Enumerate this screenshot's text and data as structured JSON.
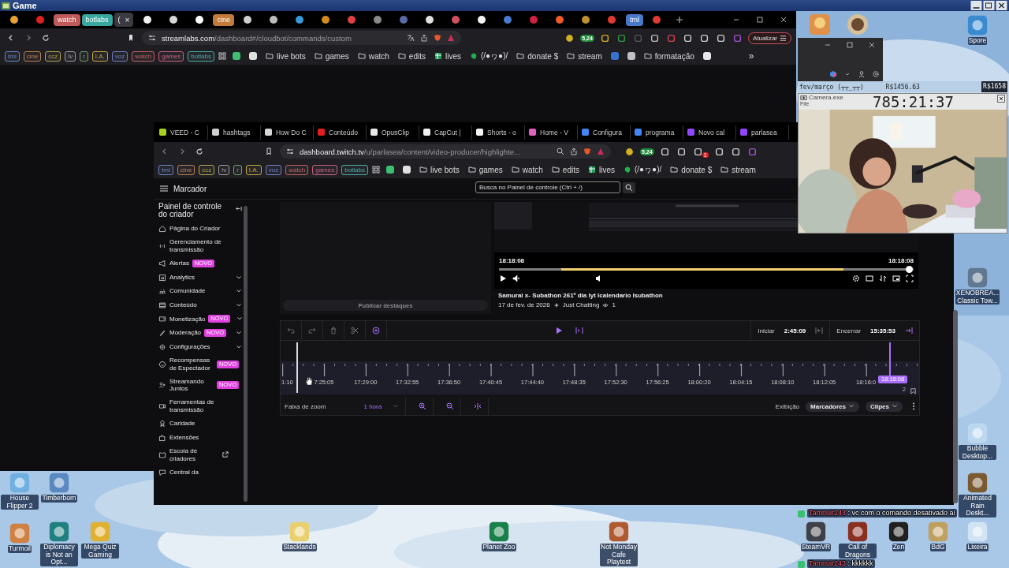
{
  "top_bar": {
    "title": "Game"
  },
  "browser": {
    "tabs": [
      {
        "kind": "icon",
        "color": "#e8a030",
        "selected": false
      },
      {
        "kind": "icon",
        "color": "#e02020",
        "selected": false
      },
      {
        "kind": "group",
        "label": "watch",
        "color": "#c05a5a",
        "selected": false
      },
      {
        "kind": "group",
        "label": "botlabs",
        "color": "#3aa8a0",
        "selected": false
      },
      {
        "kind": "text",
        "label": "(",
        "close": "×",
        "selected": true
      },
      {
        "kind": "icon",
        "color": "#f0f0f0",
        "selected": false
      },
      {
        "kind": "icon",
        "color": "#d8d8d8",
        "selected": false
      },
      {
        "kind": "icon",
        "color": "#ffffff",
        "selected": false
      },
      {
        "kind": "group",
        "label": "cine",
        "color": "#c07a3a",
        "selected": false
      },
      {
        "kind": "icon",
        "color": "#cfcfcf",
        "selected": false
      },
      {
        "kind": "icon",
        "color": "#bdbdbd",
        "selected": false
      },
      {
        "kind": "icon",
        "color": "#3a9ad8",
        "selected": false
      },
      {
        "kind": "icon",
        "color": "#d08a20",
        "selected": false
      },
      {
        "kind": "icon",
        "color": "#e04040",
        "selected": false
      },
      {
        "kind": "icon",
        "color": "#8a8a8a",
        "selected": false
      },
      {
        "kind": "icon",
        "color": "#5a6aa8",
        "selected": false
      },
      {
        "kind": "icon",
        "color": "#e0e0e0",
        "selected": false
      },
      {
        "kind": "icon",
        "color": "#d05060",
        "selected": false
      },
      {
        "kind": "icon",
        "color": "#f4f4f4",
        "selected": false
      },
      {
        "kind": "icon",
        "color": "#4a7ad0",
        "selected": false
      },
      {
        "kind": "icon",
        "color": "#d02040",
        "selected": false
      },
      {
        "kind": "icon",
        "color": "#f05a28",
        "selected": false
      },
      {
        "kind": "icon",
        "color": "#c09030",
        "selected": false
      },
      {
        "kind": "icon",
        "color": "#e03a30",
        "selected": false
      },
      {
        "kind": "group",
        "label": "tml",
        "color": "#4a78c8",
        "selected": false
      },
      {
        "kind": "icon",
        "color": "#e03a30",
        "selected": false
      }
    ],
    "url": {
      "host": "streamlabs.com",
      "path": "/dashboard#/cloudbot/commands/custom"
    },
    "extension_badge": "5,24",
    "update_button": "Atualizar",
    "bookmarks": [
      {
        "kind": "chip",
        "label": "tml",
        "color": "#6a86c8"
      },
      {
        "kind": "chip",
        "label": "cine",
        "color": "#c08050"
      },
      {
        "kind": "chip",
        "label": "ccz",
        "color": "#b8a848"
      },
      {
        "kind": "chip",
        "label": "lv",
        "color": "#a0a0a0"
      },
      {
        "kind": "chip",
        "label": "r",
        "color": "#70a070"
      },
      {
        "kind": "chip",
        "label": "I.A.",
        "color": "#c8a838"
      },
      {
        "kind": "chip",
        "label": "voz",
        "color": "#7080c8"
      },
      {
        "kind": "chip",
        "label": "watch",
        "color": "#c86060"
      },
      {
        "kind": "chip",
        "label": "games",
        "color": "#c86080"
      },
      {
        "kind": "chip",
        "label": "botlabs",
        "color": "#48b0a8"
      },
      {
        "kind": "apps"
      },
      {
        "kind": "icon",
        "color": "#3ac070"
      },
      {
        "kind": "icon",
        "color": "#e0e0e0"
      },
      {
        "kind": "folder",
        "label": "live bots"
      },
      {
        "kind": "folder",
        "label": "games"
      },
      {
        "kind": "folder",
        "label": "watch"
      },
      {
        "kind": "folder",
        "label": "edits"
      },
      {
        "kind": "sheet",
        "label": "lives"
      },
      {
        "kind": "note",
        "label": "(/●ヮ●)/"
      },
      {
        "kind": "folder",
        "label": "donate $"
      },
      {
        "kind": "folder",
        "label": "stream"
      },
      {
        "kind": "icon",
        "color": "#3a70d0"
      },
      {
        "kind": "icon",
        "color": "#c0c0c0"
      },
      {
        "kind": "folder",
        "label": "formatação"
      },
      {
        "kind": "icon",
        "color": "#e8e8e8"
      },
      {
        "kind": "overflow",
        "label": "»"
      }
    ]
  },
  "inner_browser": {
    "tabs": [
      {
        "label": "VEED - C",
        "color": "#a8d020",
        "selected": false
      },
      {
        "label": "hashtags",
        "color": "#d0d0d0",
        "selected": false
      },
      {
        "label": "How Do C",
        "color": "#d8d8d8",
        "selected": false
      },
      {
        "label": "Conteúdo",
        "color": "#e02020",
        "selected": false
      },
      {
        "label": "OpusClip",
        "color": "#e8e8e8",
        "selected": false
      },
      {
        "label": "CapCut |",
        "color": "#f0f0f0",
        "selected": false
      },
      {
        "label": "Shorts - o",
        "color": "#f4f4f4",
        "selected": false
      },
      {
        "label": "Home - V",
        "color": "#e060c0",
        "selected": false
      },
      {
        "label": "Configura",
        "color": "#4285f4",
        "selected": false
      },
      {
        "label": "programa",
        "color": "#4285f4",
        "selected": false
      },
      {
        "label": "Novo cal",
        "color": "#9146ff",
        "selected": false
      },
      {
        "label": "parlasea",
        "color": "#9146ff",
        "selected": false
      }
    ],
    "url": {
      "host": "dashboard.twitch.tv",
      "path": "/u/parlasea/content/video-producer/highlighte..."
    },
    "extension_badge": "5,24",
    "alert_badge": "1",
    "bookmarks": [
      {
        "kind": "chip",
        "label": "tml",
        "color": "#6a86c8"
      },
      {
        "kind": "chip",
        "label": "cine",
        "color": "#c08050"
      },
      {
        "kind": "chip",
        "label": "ccz",
        "color": "#b8a848"
      },
      {
        "kind": "chip",
        "label": "lv",
        "color": "#a0a0a0"
      },
      {
        "kind": "chip",
        "label": "r",
        "color": "#70a070"
      },
      {
        "kind": "chip",
        "label": "I.A.",
        "color": "#c8a838"
      },
      {
        "kind": "chip",
        "label": "voz",
        "color": "#7080c8"
      },
      {
        "kind": "chip",
        "label": "watch",
        "color": "#c86060"
      },
      {
        "kind": "chip",
        "label": "games",
        "color": "#c86080"
      },
      {
        "kind": "chip",
        "label": "botlabs",
        "color": "#48b0a8"
      },
      {
        "kind": "apps"
      },
      {
        "kind": "icon",
        "color": "#3ac070"
      },
      {
        "kind": "icon",
        "color": "#e0e0e0"
      },
      {
        "kind": "folder",
        "label": "live bots"
      },
      {
        "kind": "folder",
        "label": "games"
      },
      {
        "kind": "folder",
        "label": "watch"
      },
      {
        "kind": "folder",
        "label": "edits"
      },
      {
        "kind": "sheet",
        "label": "lives"
      },
      {
        "kind": "note",
        "label": "(/●ヮ●)/"
      },
      {
        "kind": "folder",
        "label": "donate $"
      },
      {
        "kind": "folder",
        "label": "stream"
      }
    ]
  },
  "page": {
    "menu_title": "Marcador",
    "search": {
      "placeholder": "Busca no Painel de controle (Ctrl + /)"
    },
    "sidebar": {
      "title": "Painel de controle do criador",
      "items": [
        {
          "label": "Página do Criador",
          "kind": "link",
          "selected": false
        },
        {
          "label": "Gerenciamento de transmissão",
          "kind": "link",
          "selected": false
        },
        {
          "label": "Alertas",
          "badge": "NOVO",
          "kind": "link",
          "selected": false
        },
        {
          "label": "Analytics",
          "kind": "menu",
          "selected": false
        },
        {
          "label": "Comunidade",
          "kind": "menu",
          "selected": false
        },
        {
          "label": "Conteúdo",
          "kind": "menu",
          "selected": false
        },
        {
          "label": "Monetização",
          "badge": "NOVO",
          "kind": "menu",
          "selected": false
        },
        {
          "label": "Moderação",
          "badge": "NOVO",
          "kind": "menu",
          "selected": false
        },
        {
          "label": "Configurações",
          "kind": "menu",
          "selected": false
        },
        {
          "label": "Recompensas de Espectador",
          "badge": "NOVO",
          "kind": "link",
          "selected": false
        },
        {
          "label": "Streamando Juntos",
          "badge": "NOVO",
          "kind": "link",
          "selected": false
        },
        {
          "label": "Ferramentas de transmissão",
          "kind": "link",
          "selected": false
        },
        {
          "label": "Caridade",
          "kind": "link",
          "selected": false
        },
        {
          "label": "Extensões",
          "kind": "link",
          "selected": false
        },
        {
          "label": "Escola de criadores",
          "kind": "external",
          "selected": false
        },
        {
          "label": "Central da",
          "kind": "link",
          "selected": false
        }
      ]
    },
    "publish_button": {
      "label": "Publicar destaques",
      "disabled": true
    },
    "video": {
      "time_left": "18:18:08",
      "time_right": "18:18:08",
      "level": 0.99,
      "title": "Samurai x- Subathon 261º dia lyt lcalendario lsubathon",
      "date": "17 de fev. de 2026",
      "category": "Just Chatting",
      "viewers": "1"
    },
    "editor": {
      "start_label": "Iniciar",
      "start_time": "2:45:09",
      "end_label": "Encerrar",
      "end_time": "15:35:53",
      "ticks": [
        "1:10",
        "7:25:05",
        "17:29:00",
        "17:32:55",
        "17:36:50",
        "17:40:45",
        "17:44:40",
        "17:48:35",
        "17:52:30",
        "17:56:25",
        "18:00:20",
        "18:04:15",
        "18:08:10",
        "18:12:05",
        "18:16:0"
      ],
      "marker": "18:18:08",
      "marker_count": "2",
      "zoom_label": "Faixa de zoom",
      "zoom_value": "1 hora",
      "view_label": "Exibição",
      "filters": [
        "Marcadores",
        "Clipes"
      ]
    }
  },
  "webcam": {
    "stats": [
      "fev/março (┬┬_┬┬)",
      "R$1456.63",
      "R$1658"
    ],
    "title": "Camera.exe",
    "menu": "File",
    "timer": "785:21:37"
  },
  "desktop_icons": [
    {
      "label": "Spore"
    },
    {
      "label": "XENOBREA... Classic Tow..."
    },
    {
      "label": "Bubble Desktop..."
    },
    {
      "label": "House Flipper 2"
    },
    {
      "label": "Timberborn"
    },
    {
      "label": "Animated Rain Deskt..."
    },
    {
      "label": "Turmoil"
    },
    {
      "label": "Diplomacy is Not an Opt..."
    },
    {
      "label": "Mega Quiz Gaming"
    },
    {
      "label": "Stacklands"
    },
    {
      "label": "Planet Zoo"
    },
    {
      "label": "Not Monday Cafe Playtest"
    },
    {
      "label": "SteamVR"
    },
    {
      "label": "Call of Dragons"
    },
    {
      "label": "Zen"
    },
    {
      "label": "BdG"
    },
    {
      "label": "Lixeira"
    }
  ],
  "chat": [
    {
      "name": "Tamnuir243",
      "message": ": vc com o comando desativado ai"
    },
    {
      "name": "Tamnuir243",
      "message": ": kkkkkk"
    }
  ]
}
